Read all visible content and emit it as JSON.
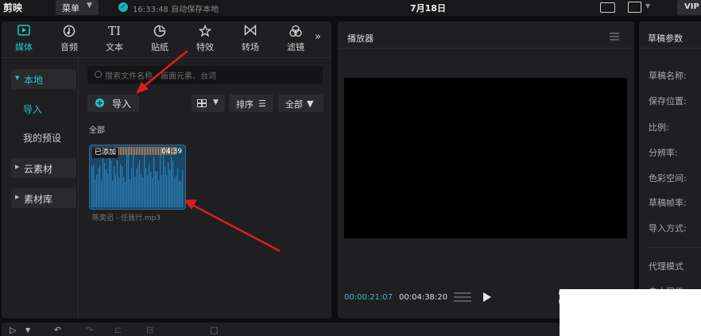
{
  "app": {
    "logo": "剪映",
    "menu_label": "菜单",
    "save_status": "16:33:48 自动保存本地",
    "title": "7月18日",
    "vip_label": "VIP"
  },
  "tabs": [
    {
      "label": "媒体",
      "icon": "media-icon",
      "active": true
    },
    {
      "label": "音频",
      "icon": "audio-icon"
    },
    {
      "label": "文本",
      "icon": "text-icon",
      "glyph": "TI"
    },
    {
      "label": "贴纸",
      "icon": "sticker-icon"
    },
    {
      "label": "特效",
      "icon": "effects-icon"
    },
    {
      "label": "转场",
      "icon": "transition-icon"
    },
    {
      "label": "滤镜",
      "icon": "filter-icon"
    }
  ],
  "sidebar": {
    "local": "本地",
    "import": "导入",
    "my_presets": "我的预设",
    "cloud": "云素材",
    "library": "素材库"
  },
  "media": {
    "search_placeholder": "搜索文件名称、画面元素、台词",
    "import_label": "导入",
    "sort_label": "排序",
    "filter_label": "全部",
    "section_all": "全部",
    "item": {
      "badge": "已添加",
      "duration": "04:39",
      "filename": "陈奕迅 - 任我行.mp3"
    }
  },
  "player": {
    "title": "播放器",
    "current_time": "00:00:21:07",
    "total_time": "00:04:38:20"
  },
  "draft": {
    "title": "草稿参数",
    "labels": [
      "草稿名称:",
      "保存位置:",
      "比例:",
      "分辨率:",
      "色彩空间:",
      "草稿帧率:",
      "导入方式:"
    ],
    "proxy_mode": "代理模式",
    "auto_cut": "自由层级"
  },
  "colors": {
    "accent": "#1ec9cc",
    "annotation_arrow": "#d81e1e",
    "waveform": "#2a7fb6"
  }
}
